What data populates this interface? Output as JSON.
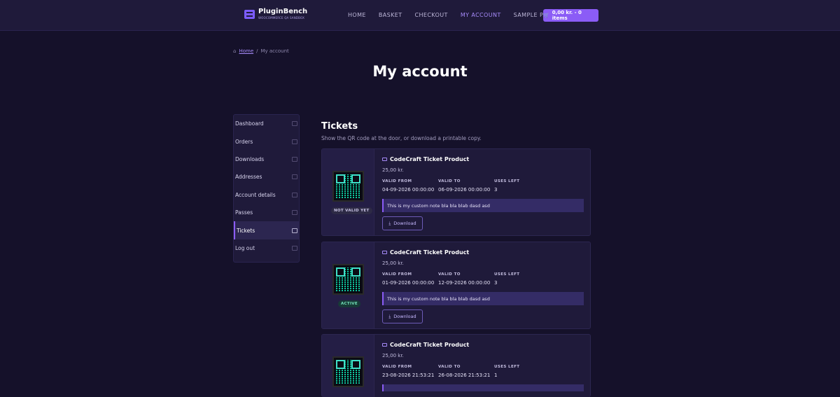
{
  "header": {
    "brand_name": "PluginBench",
    "brand_sub": "WOOCOMMERCE QA SANDBOX",
    "nav": [
      "HOME",
      "BASKET",
      "CHECKOUT",
      "MY ACCOUNT",
      "SAMPLE PAGE"
    ],
    "nav_active": "MY ACCOUNT",
    "cart_label": "0,00 kr. - 0 items"
  },
  "breadcrumb": {
    "home": "Home",
    "sep": "/",
    "current": "My account"
  },
  "page_title": "My account",
  "sidebar": {
    "items": [
      {
        "label": "Dashboard",
        "icon": "dashboard-icon"
      },
      {
        "label": "Orders",
        "icon": "basket-icon"
      },
      {
        "label": "Downloads",
        "icon": "file-icon"
      },
      {
        "label": "Addresses",
        "icon": "home-icon"
      },
      {
        "label": "Account details",
        "icon": "user-icon"
      },
      {
        "label": "Passes",
        "icon": "pass-icon"
      },
      {
        "label": "Tickets",
        "icon": "ticket-icon",
        "active": true
      },
      {
        "label": "Log out",
        "icon": "logout-icon"
      }
    ]
  },
  "tickets_section": {
    "title": "Tickets",
    "subtitle": "Show the QR code at the door, or download a printable copy.",
    "labels": {
      "valid_from": "VALID FROM",
      "valid_to": "VALID TO",
      "uses_left": "USES LEFT",
      "download": "Download"
    },
    "tickets": [
      {
        "name": "CodeCraft Ticket Product",
        "price": "25,00 kr.",
        "status": "NOT VALID YET",
        "valid_from": "04-09-2026 00:00:00",
        "valid_to": "06-09-2026 00:00:00",
        "uses_left": "3",
        "note": "This is my custom note bla bla blab dasd asd"
      },
      {
        "name": "CodeCraft Ticket Product",
        "price": "25,00 kr.",
        "status": "ACTIVE",
        "valid_from": "01-09-2026 00:00:00",
        "valid_to": "12-09-2026 00:00:00",
        "uses_left": "3",
        "note": "This is my custom note bla bla blab dasd asd"
      },
      {
        "name": "CodeCraft Ticket Product",
        "price": "25,00 kr.",
        "status": "",
        "valid_from": "23-08-2026 21:53:21",
        "valid_to": "26-08-2026 21:53:21",
        "uses_left": "1",
        "note": ""
      }
    ]
  }
}
